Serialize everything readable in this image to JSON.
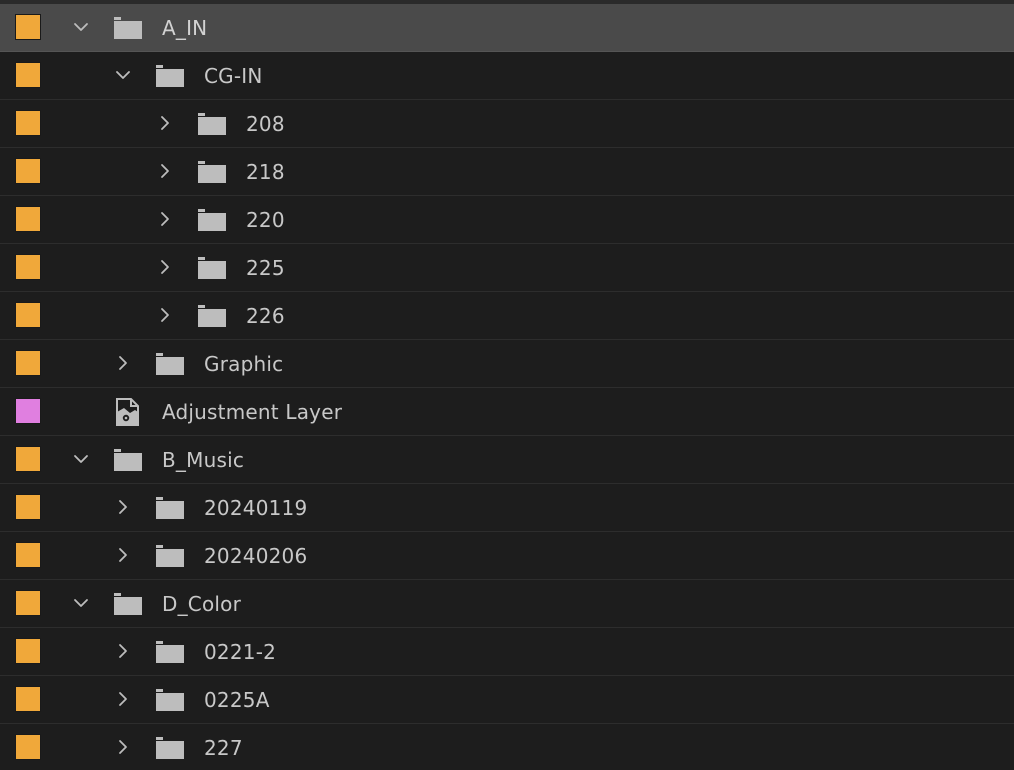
{
  "colors": {
    "background": "#1d1d1d",
    "selected_row": "#4a4a4a",
    "label_orange": "#f0a83a",
    "label_violet": "#e07fe0",
    "text": "#c8c8c8"
  },
  "items": [
    {
      "label": "A_IN",
      "depth": 0,
      "type": "folder",
      "state": "expanded",
      "color": "#f0a83a",
      "selected": true
    },
    {
      "label": "CG-IN",
      "depth": 1,
      "type": "folder",
      "state": "expanded",
      "color": "#f0a83a",
      "selected": false
    },
    {
      "label": "208",
      "depth": 2,
      "type": "folder",
      "state": "collapsed",
      "color": "#f0a83a",
      "selected": false
    },
    {
      "label": "218",
      "depth": 2,
      "type": "folder",
      "state": "collapsed",
      "color": "#f0a83a",
      "selected": false
    },
    {
      "label": "220",
      "depth": 2,
      "type": "folder",
      "state": "collapsed",
      "color": "#f0a83a",
      "selected": false
    },
    {
      "label": "225",
      "depth": 2,
      "type": "folder",
      "state": "collapsed",
      "color": "#f0a83a",
      "selected": false
    },
    {
      "label": "226",
      "depth": 2,
      "type": "folder",
      "state": "collapsed",
      "color": "#f0a83a",
      "selected": false
    },
    {
      "label": "Graphic",
      "depth": 1,
      "type": "folder",
      "state": "collapsed",
      "color": "#f0a83a",
      "selected": false
    },
    {
      "label": "Adjustment Layer",
      "depth": 0,
      "type": "adjustment-layer",
      "state": "none",
      "color": "#e07fe0",
      "selected": false
    },
    {
      "label": "B_Music",
      "depth": 0,
      "type": "folder",
      "state": "expanded",
      "color": "#f0a83a",
      "selected": false
    },
    {
      "label": "20240119",
      "depth": 1,
      "type": "folder",
      "state": "collapsed",
      "color": "#f0a83a",
      "selected": false
    },
    {
      "label": "20240206",
      "depth": 1,
      "type": "folder",
      "state": "collapsed",
      "color": "#f0a83a",
      "selected": false
    },
    {
      "label": "D_Color",
      "depth": 0,
      "type": "folder",
      "state": "expanded",
      "color": "#f0a83a",
      "selected": false
    },
    {
      "label": "0221-2",
      "depth": 1,
      "type": "folder",
      "state": "collapsed",
      "color": "#f0a83a",
      "selected": false
    },
    {
      "label": "0225A",
      "depth": 1,
      "type": "folder",
      "state": "collapsed",
      "color": "#f0a83a",
      "selected": false
    },
    {
      "label": "227",
      "depth": 1,
      "type": "folder",
      "state": "collapsed",
      "color": "#f0a83a",
      "selected": false
    }
  ]
}
